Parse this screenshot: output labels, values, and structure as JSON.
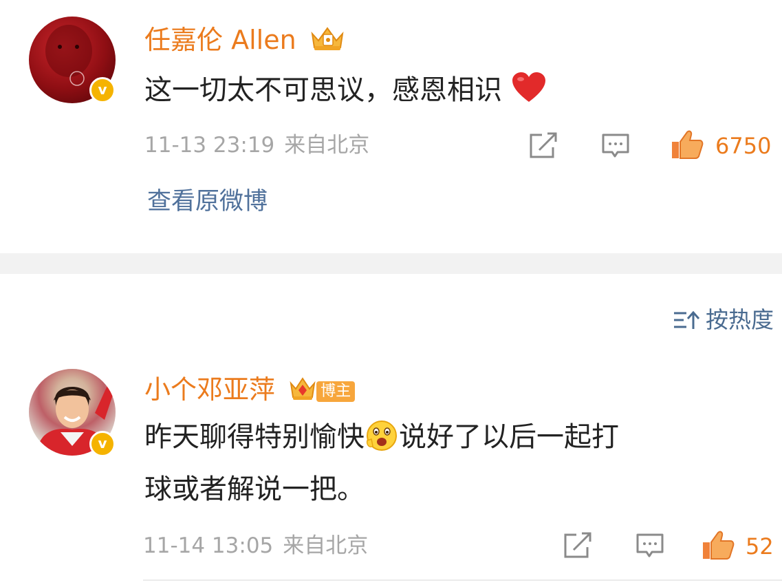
{
  "colors": {
    "username": "#eb7b1d",
    "link": "#50719b",
    "meta": "#a6a6a6",
    "like": "#eb7b1d",
    "badge": "#f5b300",
    "divider": "#f2f2f2"
  },
  "post1": {
    "username": "任嘉伦 Allen",
    "crown_icon": "crown-badge-icon",
    "verified_icon": "verified-v-icon",
    "verified_label": "v",
    "comment": "这一切太不可思议，感恩相识",
    "comment_emoji_icon": "red-heart-icon",
    "time": "11-13 23:19",
    "source": "来自北京",
    "share_icon": "share-icon",
    "comment_icon": "comment-icon",
    "like_icon": "thumbs-up-icon",
    "likes": "6750",
    "view_original": "查看原微博"
  },
  "sort": {
    "icon": "sort-icon",
    "label": "按热度"
  },
  "post2": {
    "username": "小个邓亚萍",
    "crown_icon": "crown-badge-icon",
    "host_badge": "博主",
    "verified_icon": "verified-v-icon",
    "verified_label": "v",
    "comment_line1_a": "昨天聊得特别愉快",
    "comment_emoji_icon": "happy-face-emoji-icon",
    "comment_line1_b": "说好了以后一起打",
    "comment_line2": "球或者解说一把。",
    "time": "11-14 13:05",
    "source": "来自北京",
    "share_icon": "share-icon",
    "comment_icon": "comment-icon",
    "like_icon": "thumbs-up-icon",
    "likes": "52"
  }
}
